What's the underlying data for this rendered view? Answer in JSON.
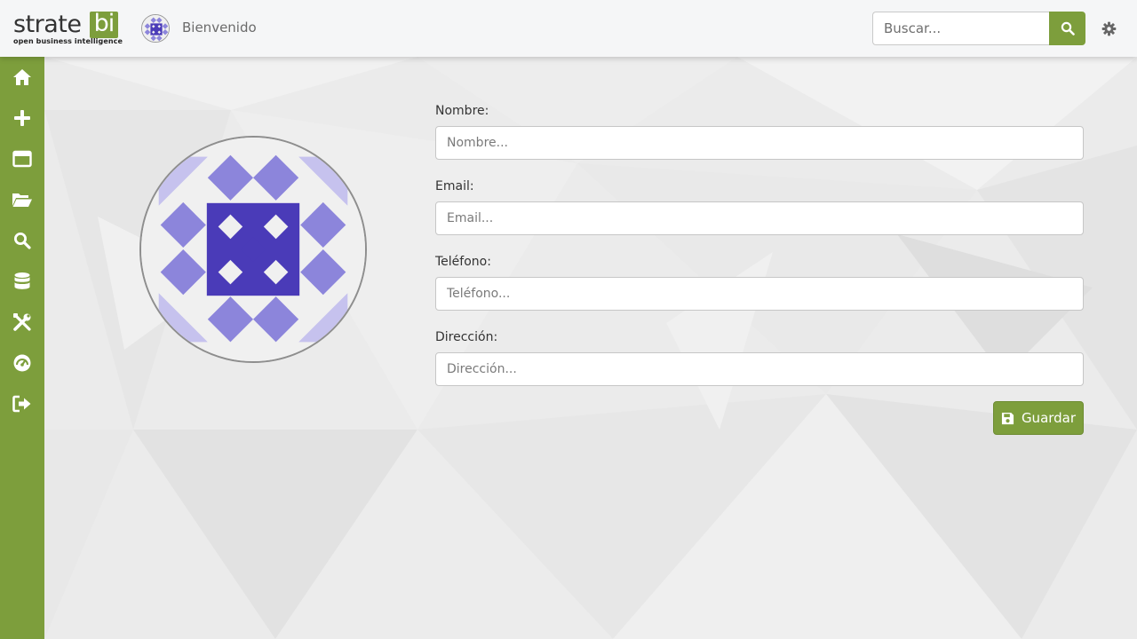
{
  "brand": {
    "logo_main": "strate",
    "logo_box": "bi",
    "logo_tagline": "open business intelligence"
  },
  "header": {
    "welcome": "Bienvenido",
    "search_placeholder": "Buscar...",
    "search_icon": "search-icon",
    "settings_icon": "gear-icon"
  },
  "sidebar": {
    "items": [
      {
        "icon": "home-icon"
      },
      {
        "icon": "plus-icon"
      },
      {
        "icon": "window-icon"
      },
      {
        "icon": "folder-open-icon"
      },
      {
        "icon": "search-icon"
      },
      {
        "icon": "database-icon"
      },
      {
        "icon": "tools-icon"
      },
      {
        "icon": "dashboard-gauge-icon"
      },
      {
        "icon": "sign-out-icon"
      }
    ]
  },
  "form": {
    "name_label": "Nombre:",
    "name_placeholder": "Nombre...",
    "email_label": "Email:",
    "email_placeholder": "Email...",
    "phone_label": "Teléfono:",
    "phone_placeholder": "Teléfono...",
    "address_label": "Dirección:",
    "address_placeholder": "Dirección...",
    "save_label": "Guardar"
  },
  "colors": {
    "accent": "#7d9e3c",
    "avatar_dark": "#4a3bb8",
    "avatar_light": "#8c85db",
    "avatar_pale": "#c6c2ee"
  }
}
